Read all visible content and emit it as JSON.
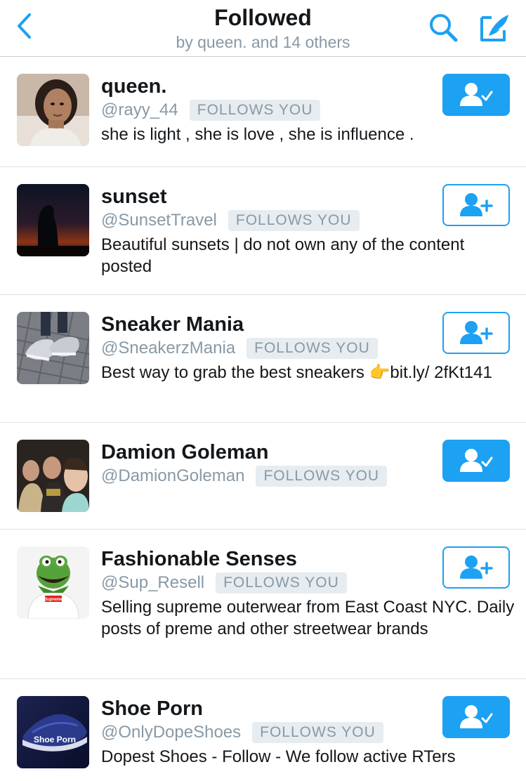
{
  "header": {
    "title": "Followed",
    "subtitle": "by queen. and 14 others"
  },
  "icons": {
    "back": "chevron-left-icon",
    "search": "search-icon",
    "compose": "compose-icon",
    "following": "person-check-icon",
    "follow": "person-add-icon"
  },
  "colors": {
    "accent": "#1da1f2",
    "secondary_text": "#8899a6",
    "badge_bg": "#e6ecf0"
  },
  "users": [
    {
      "name": "queen.",
      "handle": "@rayy_44",
      "badge": "FOLLOWS YOU",
      "bio": "she is light , she is love , she is influence .",
      "following": true
    },
    {
      "name": "sunset",
      "handle": "@SunsetTravel",
      "badge": "FOLLOWS YOU",
      "bio": "Beautiful sunsets | do not own any of the content posted",
      "following": false
    },
    {
      "name": "Sneaker Mania",
      "handle": "@SneakerzMania",
      "badge": "FOLLOWS YOU",
      "bio": "Best way to grab the best sneakers 👉bit.ly/ 2fKt141",
      "following": false
    },
    {
      "name": "Damion Goleman",
      "handle": "@DamionGoleman",
      "badge": "FOLLOWS YOU",
      "bio": "",
      "following": true
    },
    {
      "name": "Fashionable Senses",
      "handle": "@Sup_Resell",
      "badge": "FOLLOWS YOU",
      "bio": "Selling supreme outerwear from East Coast NYC. Daily posts of preme and other streetwear brands",
      "following": false
    },
    {
      "name": "Shoe Porn",
      "handle": "@OnlyDopeShoes",
      "badge": "FOLLOWS YOU",
      "bio": "Dopest Shoes - Follow - We follow active RTers",
      "following": true
    }
  ],
  "avatar_texts": {
    "shoe_porn": "Shoe Porn",
    "supreme": "Supreme"
  }
}
